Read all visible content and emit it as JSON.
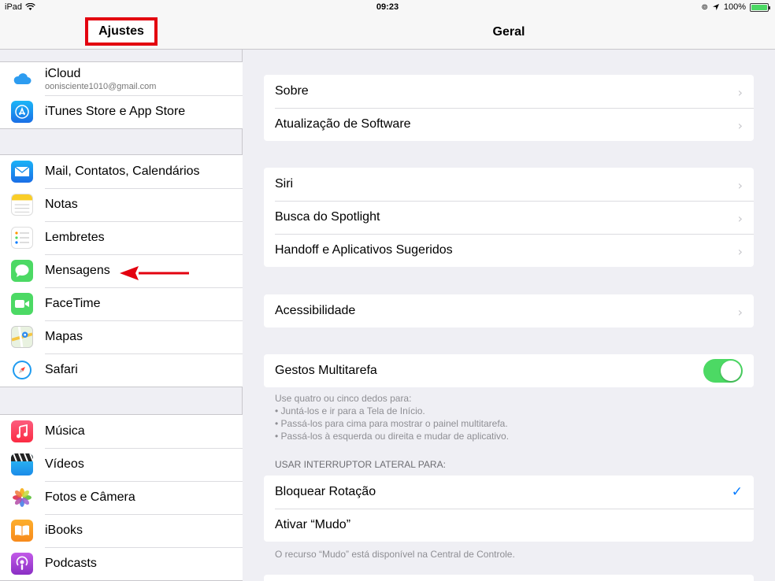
{
  "status_bar": {
    "device": "iPad",
    "time": "09:23",
    "battery": "100%",
    "battery_level": 1.0
  },
  "sidebar": {
    "title": "Ajustes",
    "account": {
      "label": "iCloud",
      "email": "oonisciente1010@gmail.com"
    },
    "groups": [
      {
        "items": [
          {
            "label": "iTunes Store e App Store",
            "icon": "app-store-icon"
          }
        ]
      },
      {
        "items": [
          {
            "label": "Mail, Contatos, Calendários",
            "icon": "mail-icon"
          },
          {
            "label": "Notas",
            "icon": "notes-icon"
          },
          {
            "label": "Lembretes",
            "icon": "reminders-icon"
          },
          {
            "label": "Mensagens",
            "icon": "messages-icon"
          },
          {
            "label": "FaceTime",
            "icon": "facetime-icon"
          },
          {
            "label": "Mapas",
            "icon": "maps-icon"
          },
          {
            "label": "Safari",
            "icon": "safari-icon"
          }
        ]
      },
      {
        "items": [
          {
            "label": "Música",
            "icon": "music-icon"
          },
          {
            "label": "Vídeos",
            "icon": "videos-icon"
          },
          {
            "label": "Fotos e Câmera",
            "icon": "photos-icon"
          },
          {
            "label": "iBooks",
            "icon": "ibooks-icon"
          },
          {
            "label": "Podcasts",
            "icon": "podcasts-icon"
          }
        ]
      }
    ]
  },
  "main": {
    "title": "Geral",
    "sections": [
      {
        "rows": [
          {
            "label": "Sobre"
          },
          {
            "label": "Atualização de Software"
          }
        ]
      },
      {
        "rows": [
          {
            "label": "Siri"
          },
          {
            "label": "Busca do Spotlight"
          },
          {
            "label": "Handoff e Aplicativos Sugeridos"
          }
        ]
      },
      {
        "rows": [
          {
            "label": "Acessibilidade"
          }
        ]
      }
    ],
    "multitasking": {
      "label": "Gestos Multitarefa",
      "enabled": true,
      "footer_lines": [
        "Use quatro ou cinco dedos para:",
        "• Juntá-los e ir para a Tela de Início.",
        "• Passá-los para cima para mostrar o painel multitarefa.",
        "• Passá-los à esquerda ou direita e mudar de aplicativo."
      ]
    },
    "side_switch": {
      "header": "USAR INTERRUPTOR LATERAL PARA:",
      "options": [
        {
          "label": "Bloquear Rotação",
          "selected": true
        },
        {
          "label": "Ativar “Mudo”",
          "selected": false
        }
      ],
      "footer": "O recurso “Mudo” está disponível na Central de Controle."
    }
  },
  "colors": {
    "highlight": "#e3000f",
    "toggle_on": "#4cd964",
    "accent": "#007aff"
  }
}
